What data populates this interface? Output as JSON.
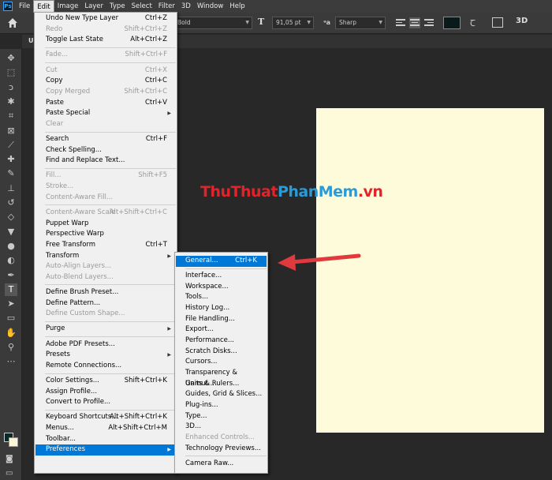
{
  "app": {
    "logo": "Ps"
  },
  "menubar": {
    "items": [
      "File",
      "Edit",
      "Image",
      "Layer",
      "Type",
      "Select",
      "Filter",
      "3D",
      "Window",
      "Help"
    ],
    "active": "Edit"
  },
  "options": {
    "font_style": "Bold",
    "font_size": "91,05 pt",
    "antialias": "Sharp",
    "text_color": "#0a1a1a",
    "three_d": "3D"
  },
  "tab": {
    "label": "U"
  },
  "watermark": {
    "part1": "ThuThuat",
    "part2": "PhanMem",
    "part3": ".vn"
  },
  "colors": {
    "highlight": "#0078d7",
    "arrow": "#e0393e",
    "paper": "#fdfbd9"
  },
  "edit_menu": [
    {
      "label": "Undo New Type Layer",
      "shortcut": "Ctrl+Z",
      "enabled": true
    },
    {
      "label": "Redo",
      "shortcut": "Shift+Ctrl+Z",
      "enabled": false
    },
    {
      "label": "Toggle Last State",
      "shortcut": "Alt+Ctrl+Z",
      "enabled": true
    },
    {
      "sep": true
    },
    {
      "label": "Fade...",
      "shortcut": "Shift+Ctrl+F",
      "enabled": false
    },
    {
      "sep": true
    },
    {
      "label": "Cut",
      "shortcut": "Ctrl+X",
      "enabled": false
    },
    {
      "label": "Copy",
      "shortcut": "Ctrl+C",
      "enabled": true
    },
    {
      "label": "Copy Merged",
      "shortcut": "Shift+Ctrl+C",
      "enabled": false
    },
    {
      "label": "Paste",
      "shortcut": "Ctrl+V",
      "enabled": true
    },
    {
      "label": "Paste Special",
      "shortcut": "",
      "enabled": true,
      "submenu": true
    },
    {
      "label": "Clear",
      "shortcut": "",
      "enabled": false
    },
    {
      "sep": true
    },
    {
      "label": "Search",
      "shortcut": "Ctrl+F",
      "enabled": true
    },
    {
      "label": "Check Spelling...",
      "shortcut": "",
      "enabled": true
    },
    {
      "label": "Find and Replace Text...",
      "shortcut": "",
      "enabled": true
    },
    {
      "sep": true
    },
    {
      "label": "Fill...",
      "shortcut": "Shift+F5",
      "enabled": false
    },
    {
      "label": "Stroke...",
      "shortcut": "",
      "enabled": false
    },
    {
      "label": "Content-Aware Fill...",
      "shortcut": "",
      "enabled": false
    },
    {
      "sep": true
    },
    {
      "label": "Content-Aware Scale",
      "shortcut": "Alt+Shift+Ctrl+C",
      "enabled": false
    },
    {
      "label": "Puppet Warp",
      "shortcut": "",
      "enabled": true
    },
    {
      "label": "Perspective Warp",
      "shortcut": "",
      "enabled": true
    },
    {
      "label": "Free Transform",
      "shortcut": "Ctrl+T",
      "enabled": true
    },
    {
      "label": "Transform",
      "shortcut": "",
      "enabled": true,
      "submenu": true
    },
    {
      "label": "Auto-Align Layers...",
      "shortcut": "",
      "enabled": false
    },
    {
      "label": "Auto-Blend Layers...",
      "shortcut": "",
      "enabled": false
    },
    {
      "sep": true
    },
    {
      "label": "Define Brush Preset...",
      "shortcut": "",
      "enabled": true
    },
    {
      "label": "Define Pattern...",
      "shortcut": "",
      "enabled": true
    },
    {
      "label": "Define Custom Shape...",
      "shortcut": "",
      "enabled": false
    },
    {
      "sep": true
    },
    {
      "label": "Purge",
      "shortcut": "",
      "enabled": true,
      "submenu": true
    },
    {
      "sep": true
    },
    {
      "label": "Adobe PDF Presets...",
      "shortcut": "",
      "enabled": true
    },
    {
      "label": "Presets",
      "shortcut": "",
      "enabled": true,
      "submenu": true
    },
    {
      "label": "Remote Connections...",
      "shortcut": "",
      "enabled": true
    },
    {
      "sep": true
    },
    {
      "label": "Color Settings...",
      "shortcut": "Shift+Ctrl+K",
      "enabled": true
    },
    {
      "label": "Assign Profile...",
      "shortcut": "",
      "enabled": true
    },
    {
      "label": "Convert to Profile...",
      "shortcut": "",
      "enabled": true
    },
    {
      "sep": true
    },
    {
      "label": "Keyboard Shortcuts...",
      "shortcut": "Alt+Shift+Ctrl+K",
      "enabled": true
    },
    {
      "label": "Menus...",
      "shortcut": "Alt+Shift+Ctrl+M",
      "enabled": true
    },
    {
      "label": "Toolbar...",
      "shortcut": "",
      "enabled": true
    },
    {
      "label": "Preferences",
      "shortcut": "",
      "enabled": true,
      "submenu": true,
      "highlighted": true
    }
  ],
  "preferences_menu": [
    {
      "label": "General...",
      "shortcut": "Ctrl+K",
      "enabled": true,
      "highlighted": true
    },
    {
      "sep": true
    },
    {
      "label": "Interface...",
      "shortcut": "",
      "enabled": true
    },
    {
      "label": "Workspace...",
      "shortcut": "",
      "enabled": true
    },
    {
      "label": "Tools...",
      "shortcut": "",
      "enabled": true
    },
    {
      "label": "History Log...",
      "shortcut": "",
      "enabled": true
    },
    {
      "label": "File Handling...",
      "shortcut": "",
      "enabled": true
    },
    {
      "label": "Export...",
      "shortcut": "",
      "enabled": true
    },
    {
      "label": "Performance...",
      "shortcut": "",
      "enabled": true
    },
    {
      "label": "Scratch Disks...",
      "shortcut": "",
      "enabled": true
    },
    {
      "label": "Cursors...",
      "shortcut": "",
      "enabled": true
    },
    {
      "label": "Transparency & Gamut...",
      "shortcut": "",
      "enabled": true
    },
    {
      "label": "Units & Rulers...",
      "shortcut": "",
      "enabled": true
    },
    {
      "label": "Guides, Grid & Slices...",
      "shortcut": "",
      "enabled": true
    },
    {
      "label": "Plug-ins...",
      "shortcut": "",
      "enabled": true
    },
    {
      "label": "Type...",
      "shortcut": "",
      "enabled": true
    },
    {
      "label": "3D...",
      "shortcut": "",
      "enabled": true
    },
    {
      "label": "Enhanced Controls...",
      "shortcut": "",
      "enabled": false
    },
    {
      "label": "Technology Previews...",
      "shortcut": "",
      "enabled": true
    },
    {
      "sep": true
    },
    {
      "label": "Camera Raw...",
      "shortcut": "",
      "enabled": true
    }
  ],
  "tools": [
    "move-tool",
    "marquee-tool",
    "lasso-tool",
    "magic-wand-tool",
    "crop-tool",
    "frame-tool",
    "eyedropper-tool",
    "healing-brush-tool",
    "brush-tool",
    "clone-stamp-tool",
    "history-brush-tool",
    "eraser-tool",
    "paint-bucket-tool",
    "blur-tool",
    "dodge-tool",
    "pen-tool",
    "type-tool",
    "path-selection-tool",
    "rectangle-tool",
    "hand-tool",
    "zoom-tool",
    "more-tools"
  ]
}
